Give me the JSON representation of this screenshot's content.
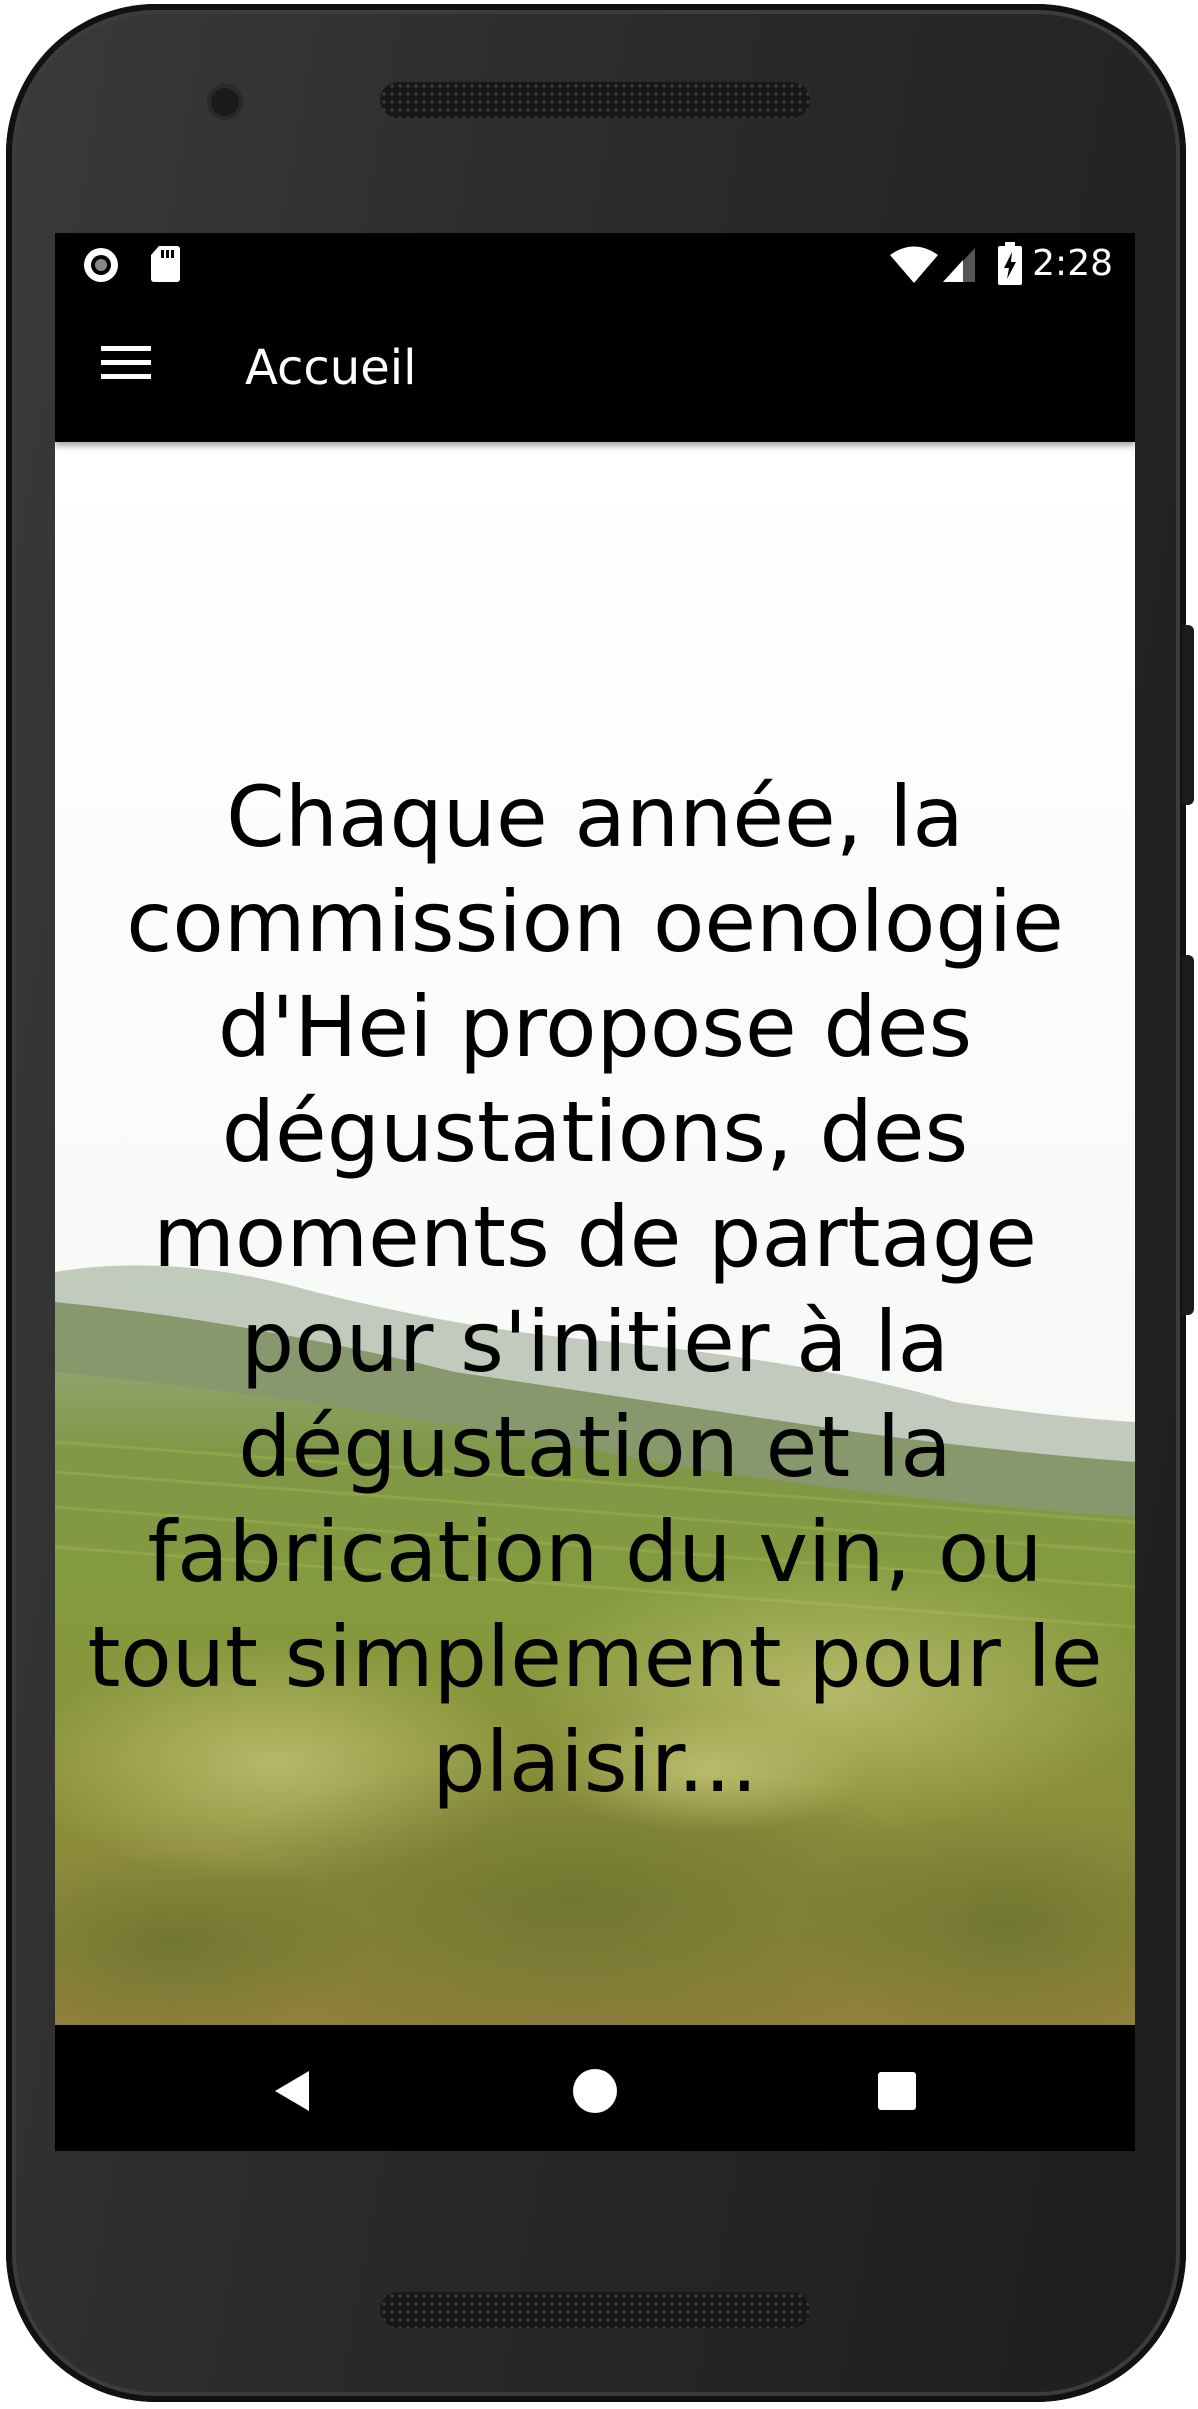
{
  "status_bar": {
    "time": "2:28",
    "left_icons": [
      "record-icon",
      "sd-card-icon"
    ],
    "right_icons": [
      "wifi-icon",
      "signal-icon",
      "battery-charging-icon"
    ]
  },
  "app_bar": {
    "title": "Accueil",
    "menu_icon": "menu-icon"
  },
  "main": {
    "intro": "Chaque année, la commission oenologie d'Hei propose des dégustations, des moments de partage pour s'initier à la dégustation et la fabrication du vin, ou tout simplement pour le plaisir...",
    "background": "vineyard-landscape-image"
  },
  "nav_bar": {
    "buttons": [
      "back-icon",
      "home-icon",
      "recents-icon"
    ]
  },
  "colors": {
    "bar_background": "#000000",
    "bar_foreground": "#ffffff",
    "content_background": "#ffffff",
    "text": "#000000"
  }
}
